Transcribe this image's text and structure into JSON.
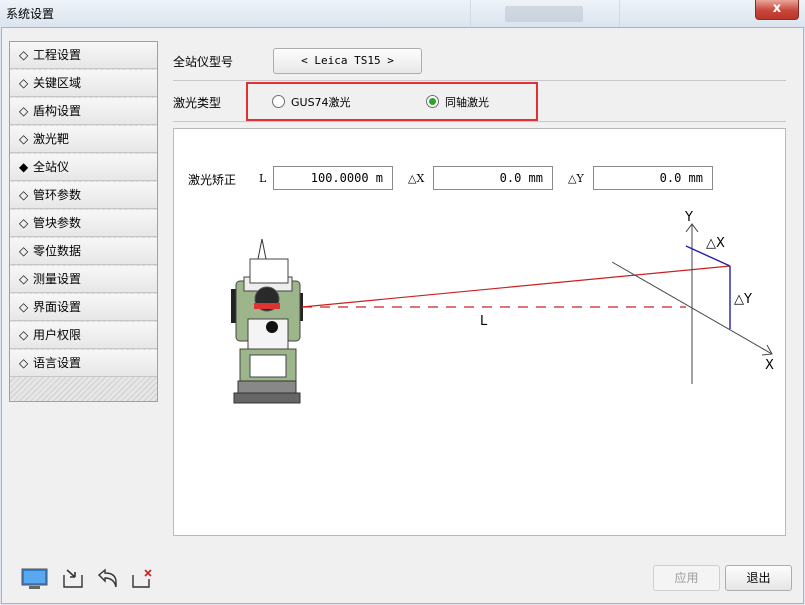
{
  "window": {
    "title": "系统设置",
    "close": "x"
  },
  "sidebar": {
    "items": [
      {
        "marker": "◇",
        "label": "工程设置"
      },
      {
        "marker": "◇",
        "label": "关键区域"
      },
      {
        "marker": "◇",
        "label": "盾构设置"
      },
      {
        "marker": "◇",
        "label": "激光靶"
      },
      {
        "marker": "◆",
        "label": "全站仪"
      },
      {
        "marker": "◇",
        "label": "管环参数"
      },
      {
        "marker": "◇",
        "label": "管块参数"
      },
      {
        "marker": "◇",
        "label": "零位数据"
      },
      {
        "marker": "◇",
        "label": "测量设置"
      },
      {
        "marker": "◇",
        "label": "界面设置"
      },
      {
        "marker": "◇",
        "label": "用户权限"
      },
      {
        "marker": "◇",
        "label": "语言设置"
      }
    ],
    "selected_index": 4
  },
  "model": {
    "label": "全站仪型号",
    "value": "< Leica TS15 >"
  },
  "laser_type": {
    "label": "激光类型",
    "options": [
      {
        "label": "GUS74激光",
        "selected": false
      },
      {
        "label": "同轴激光",
        "selected": true
      }
    ]
  },
  "calibration": {
    "label": "激光矫正",
    "l_label": "L",
    "l_value": "100.0000 m",
    "dx_label": "△X",
    "dx_value": "0.0 mm",
    "dy_label": "△Y",
    "dy_value": "0.0 mm"
  },
  "diagram": {
    "y_axis": "Y",
    "x_axis": "X",
    "dx": "△X",
    "dy": "△Y",
    "distance": "L",
    "laser_color": "#cc2020"
  },
  "buttons": {
    "apply": "应用",
    "exit": "退出"
  },
  "toolbar": [
    "monitor-icon",
    "import-icon",
    "undo-icon",
    "delete-icon"
  ]
}
